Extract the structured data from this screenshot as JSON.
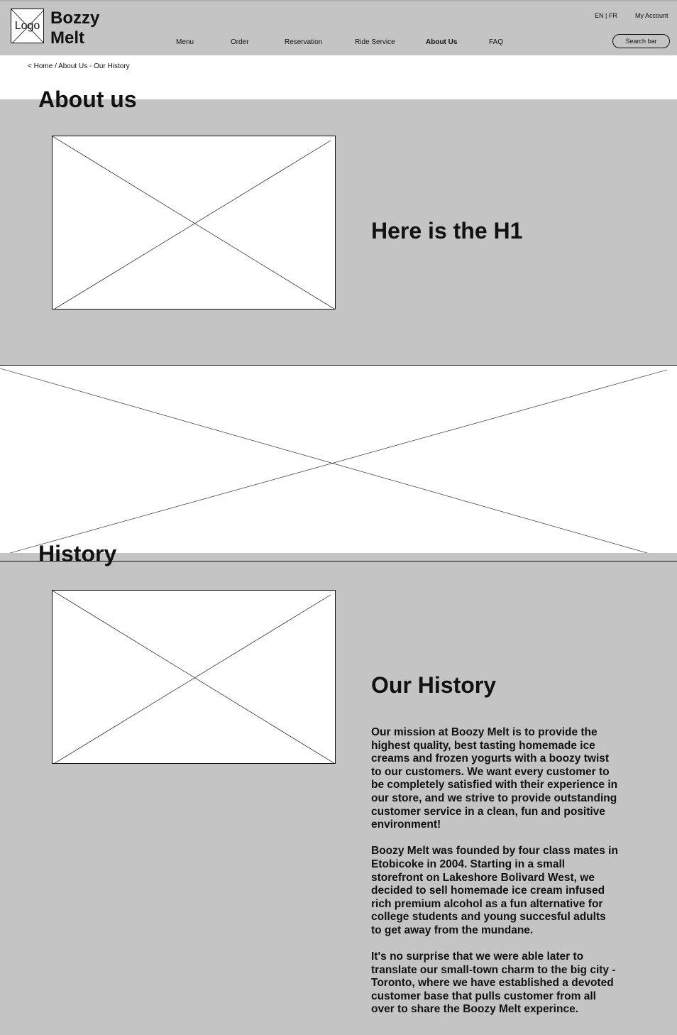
{
  "header": {
    "logo_label": "Logo",
    "brand_line1": "Bozzy",
    "brand_line2": "Melt",
    "nav": [
      {
        "label": "Menu"
      },
      {
        "label": "Order"
      },
      {
        "label": "Reservation"
      },
      {
        "label": "Ride Service"
      },
      {
        "label": "About Us",
        "active": true
      },
      {
        "label": "FAQ"
      }
    ],
    "lang_switch": "EN | FR",
    "account_label": "My Account",
    "search_placeholder": "Search bar"
  },
  "breadcrumb": "< Home / About Us - Our History",
  "about": {
    "title": "About us",
    "h1": "Here is the H1"
  },
  "history": {
    "title": "History",
    "heading": "Our History",
    "paragraphs": [
      "Our mission at Boozy Melt is to provide the highest quality, best tasting homemade ice creams and frozen yogurts with a boozy twist to our customers. We want every customer to be completely satisfied with their experience in our store, and we strive to provide outstanding customer service in a clean, fun and positive environment!",
      "Boozy Melt was founded by four class mates in Etobicoke in 2004. Starting in a small storefront on Lakeshore Bolivard West, we decided to sell homemade ice cream infused rich premium alcohol as a fun alternative for college students and young succesful adults to get away from the mundane.",
      "It's no surprise that we were able later to translate our small-town charm to the big city - Toronto, where we have established a devoted customer base that pulls customer from all over to share the Boozy Melt experince."
    ]
  },
  "colors": {
    "gray": "#c4c4c4",
    "white": "#ffffff",
    "ink": "#111111"
  }
}
